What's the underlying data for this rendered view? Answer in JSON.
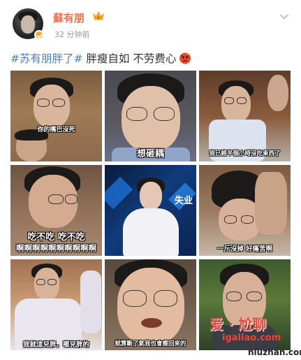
{
  "post": {
    "author": "蘇有朋",
    "time": "32 分钟前",
    "hashtag": "#苏有朋胖了#",
    "text": " 胖瘦自如 不劳费心",
    "icons": {
      "avatar": "avatar-photo",
      "verified": "verified-badge-icon",
      "member": "crown-icon",
      "menu": "chevron-down-icon",
      "emoji": "angry-face-emoji"
    }
  },
  "grid": {
    "captions": [
      "你的嘴巴沒死",
      "想砸耦",
      "我已經半個小時沒吃東西了",
      "吃不吃 吃不吃",
      "啊啊啊啊啊啊啊啊啊啊",
      "",
      "一斤沒掉 好痛苦啊",
      "我就這兒胖，哪兒胖的",
      "就算斷了氣我也會瘦回來的"
    ],
    "tag": "失业"
  },
  "watermark": {
    "line1": "爱 · 尬聊",
    "line2": "igaliao.com",
    "line3": "niuzhan.com"
  }
}
